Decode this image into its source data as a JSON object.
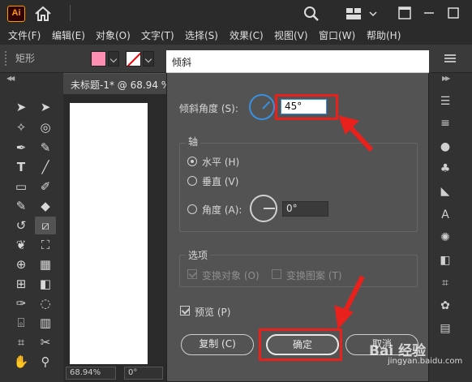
{
  "app": {
    "logo_text": "Ai"
  },
  "menu": [
    "文件(F)",
    "编辑(E)",
    "对象(O)",
    "文字(T)",
    "选择(S)",
    "效果(C)",
    "视图(V)",
    "窗口(W)",
    "帮助(H)"
  ],
  "control_bar": {
    "label": "矩形",
    "fill_color": "#ff8fb2"
  },
  "document": {
    "tab_title": "未标题-1* @ 68.94 %",
    "zoom": "68.94%",
    "rotation": "0°"
  },
  "dialog": {
    "title": "倾斜",
    "shear_angle_label": "倾斜角度",
    "shear_angle_shortcut": "(S)",
    "colon": ":",
    "shear_angle_value": "45°",
    "axis": {
      "title": "轴",
      "horizontal_label": "水平",
      "horizontal_shortcut": "(H)",
      "vertical_label": "垂直",
      "vertical_shortcut": "(V)",
      "angle_label": "角度",
      "angle_shortcut": "(A)",
      "angle_value": "0°",
      "selected": "horizontal"
    },
    "options": {
      "title": "选项",
      "transform_objects": "变换对象",
      "transform_objects_shortcut": "(O)",
      "transform_patterns": "变换图案",
      "transform_patterns_shortcut": "(T)"
    },
    "preview_label": "预览",
    "preview_shortcut": "(P)",
    "preview_checked": true,
    "copy_button": "复制",
    "copy_shortcut": "(C)",
    "ok_button": "确定",
    "cancel_button": "取消"
  },
  "watermark": {
    "text": "Bai 经验",
    "url": "jingyan.baidu.com"
  },
  "annotation_color": "#e8211c"
}
